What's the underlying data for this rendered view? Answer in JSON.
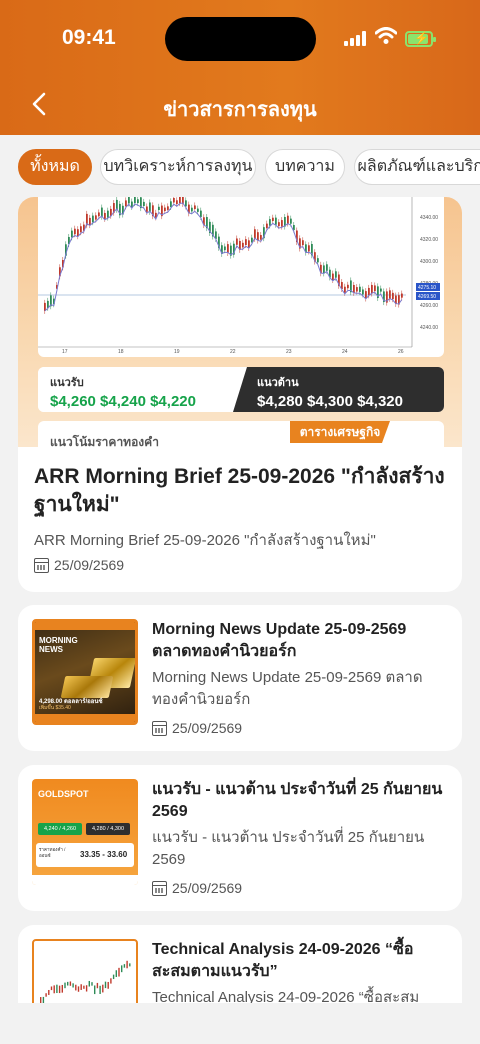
{
  "status": {
    "time": "09:41"
  },
  "header": {
    "title": "ข่าวสารการลงทุน"
  },
  "tabs": [
    {
      "label": "ทั้งหมด",
      "active": true
    },
    {
      "label": "บทวิเคราะห์การลงทุน",
      "active": false
    },
    {
      "label": "บทความ",
      "active": false
    },
    {
      "label": "ผลิตภัณฑ์และบริการ",
      "active": false
    }
  ],
  "hero": {
    "chart_x_ticks": [
      "17",
      "18",
      "19",
      "22",
      "23",
      "24",
      "26"
    ],
    "chart_y_ticks": [
      "4340.00",
      "4320.00",
      "4300.00",
      "4280.00",
      "4260.00",
      "4240.00"
    ],
    "chart_price_tags": [
      "4275.10",
      "4269.50"
    ],
    "support_label": "แนวรับ",
    "support_value": "$4,260 $4,240 $4,220",
    "resistance_label": "แนวต้าน",
    "resistance_value": "$4,280 $4,300 $4,320",
    "gold_trend_label": "แนวโน้มราคาทองคำ",
    "calendar_tag": "ตารางเศรษฐกิจ",
    "title": "ARR Morning Brief 25-09-2026 \"กำลังสร้างฐานใหม่\"",
    "subtitle": "ARR Morning Brief 25-09-2026 \"กำลังสร้างฐานใหม่\"",
    "date": "25/09/2569"
  },
  "articles": [
    {
      "title": "Morning News Update 25-09-2569 ตลาดทองคำนิวยอร์ก",
      "subtitle": "Morning News Update 25-09-2569 ตลาดทองคำนิวยอร์ก",
      "date": "25/09/2569",
      "thumb": {
        "line1": "MORNING",
        "line2": "NEWS",
        "price": "4,298.00 ดอลลาร์/ออนซ์",
        "change": "เพิ่มขึ้น $35.40"
      }
    },
    {
      "title": "แนวรับ - แนวต้าน ประจำวันที่ 25 กันยายน  2569",
      "subtitle": "แนวรับ - แนวต้าน ประจำวันที่ 25 กันยายน 2569",
      "date": "25/09/2569",
      "thumb": {
        "brand": "GOLDSPOT",
        "support": "4,240 / 4,260",
        "resistance": "4,280 / 4,300",
        "range_label": "ราคาทองคำ / ออนซ์",
        "range": "33.35 - 33.60"
      }
    },
    {
      "title": "Technical Analysis 24-09-2026 “ซื้อสะสมตามแนวรับ”",
      "subtitle": "Technical Analysis 24-09-2026 “ซื้อสะสม",
      "date": ""
    }
  ]
}
